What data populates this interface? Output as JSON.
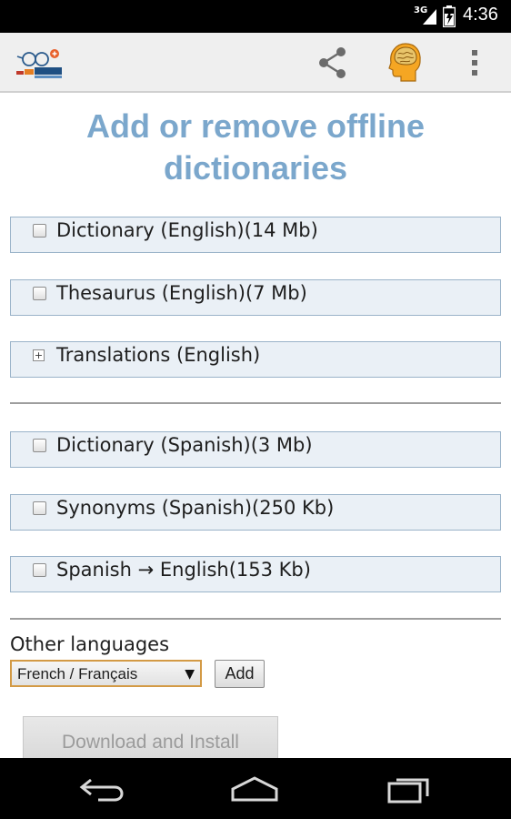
{
  "status_bar": {
    "network": "3G",
    "time": "4:36"
  },
  "action_bar": {
    "logo_icon": "free-dictionary-logo",
    "share_icon": "share-icon",
    "brain_icon": "brain-icon",
    "overflow_icon": "overflow-menu-icon"
  },
  "title": {
    "line1": "Add or remove offline",
    "line2": "dictionaries"
  },
  "english_group": [
    {
      "label": "Dictionary (English)(14 Mb)",
      "control": "checkbox",
      "checked": false
    },
    {
      "label": "Thesaurus (English)(7 Mb)",
      "control": "checkbox",
      "checked": false
    },
    {
      "label": "Translations (English)",
      "control": "expander",
      "expander_glyph": "+"
    }
  ],
  "spanish_group": [
    {
      "label": "Dictionary (Spanish)(3 Mb)",
      "control": "checkbox",
      "checked": false
    },
    {
      "label": "Synonyms (Spanish)(250 Kb)",
      "control": "checkbox",
      "checked": false
    },
    {
      "label": "Spanish → English(153 Kb)",
      "control": "checkbox",
      "checked": false
    }
  ],
  "other_languages": {
    "label": "Other languages",
    "selected": "French / Français",
    "dropdown_arrow": "▼",
    "add_label": "Add"
  },
  "download_label": "Download and Install",
  "colors": {
    "title": "#7ba7cc",
    "row_background": "#eaf0f6",
    "row_border": "#9ab3c9",
    "select_border": "#d39a45"
  }
}
